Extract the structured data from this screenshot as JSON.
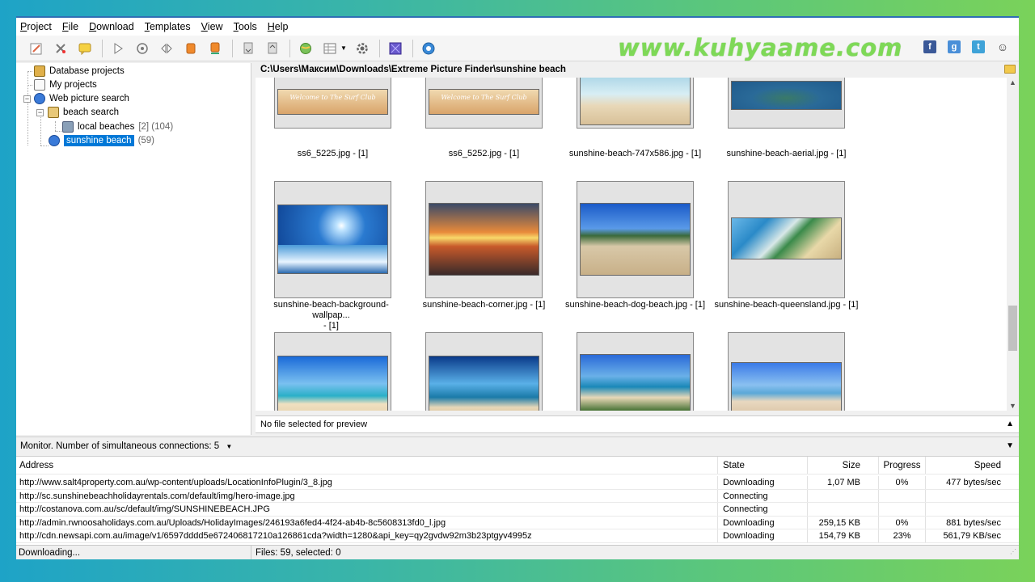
{
  "menu": [
    "Project",
    "File",
    "Download",
    "Templates",
    "View",
    "Tools",
    "Help"
  ],
  "menu_access": [
    "P",
    "F",
    "D",
    "T",
    "V",
    "T",
    "H"
  ],
  "watermark": "www.kuhyaame.com",
  "tree": {
    "database_projects": "Database projects",
    "my_projects": "My projects",
    "web_picture_search": "Web picture search",
    "beach_search": "beach search",
    "local_beaches": "local beaches",
    "local_beaches_count": "[2] (104)",
    "sunshine_beach": "sunshine beach",
    "sunshine_beach_count": "(59)"
  },
  "path": "C:\\Users\\Максим\\Downloads\\Extreme Picture Finder\\sunshine beach",
  "thumbnails": {
    "row1": [
      "ss6_5225.jpg - [1]",
      "ss6_5252.jpg - [1]",
      "sunshine-beach-747x586.jpg - [1]",
      "sunshine-beach-aerial.jpg - [1]"
    ],
    "row2_0a": "sunshine-beach-background-wallpap...",
    "row2_0b": "- [1]",
    "row2": [
      "sunshine-beach-background-wallpap... - [1]",
      "sunshine-beach-corner.jpg - [1]",
      "sunshine-beach-dog-beach.jpg - [1]",
      "sunshine-beach-queensland.jpg - [1]"
    ],
    "surf_sign": "Welcome to The Surf Club"
  },
  "preview_text": "No file selected for preview",
  "monitor": "Monitor. Number of simultaneous connections: 5",
  "downloads": {
    "headers": {
      "address": "Address",
      "state": "State",
      "size": "Size",
      "progress": "Progress",
      "speed": "Speed"
    },
    "rows": [
      {
        "address": "http://www.salt4property.com.au/wp-content/uploads/LocationInfoPlugin/3_8.jpg",
        "state": "Downloading",
        "size": "1,07 MB",
        "progress": "0%",
        "speed": "477 bytes/sec"
      },
      {
        "address": "http://sc.sunshinebeachholidayrentals.com/default/img/hero-image.jpg",
        "state": "Connecting",
        "size": "",
        "progress": "",
        "speed": ""
      },
      {
        "address": "http://costanova.com.au/sc/default/img/SUNSHINEBEACH.JPG",
        "state": "Connecting",
        "size": "",
        "progress": "",
        "speed": ""
      },
      {
        "address": "http://admin.rwnoosaholidays.com.au/Uploads/HolidayImages/246193a6fed4-4f24-ab4b-8c5608313fd0_l.jpg",
        "state": "Downloading",
        "size": "259,15 KB",
        "progress": "0%",
        "speed": "881 bytes/sec"
      },
      {
        "address": "http://cdn.newsapi.com.au/image/v1/6597dddd5e672406817210a126861cda?width=1280&api_key=qy2gvdw92m3b23ptgyv4995z",
        "state": "Downloading",
        "size": "154,79 KB",
        "progress": "23%",
        "speed": "561,79 KB/sec"
      }
    ]
  },
  "status": {
    "left": "Downloading...",
    "right": "Files: 59, selected: 0"
  },
  "colors": {
    "accent": "#0078d7",
    "watermark": "#7ed957",
    "facebook": "#3b5998",
    "google": "#4a8fd8",
    "twitter": "#3fa3d8"
  }
}
